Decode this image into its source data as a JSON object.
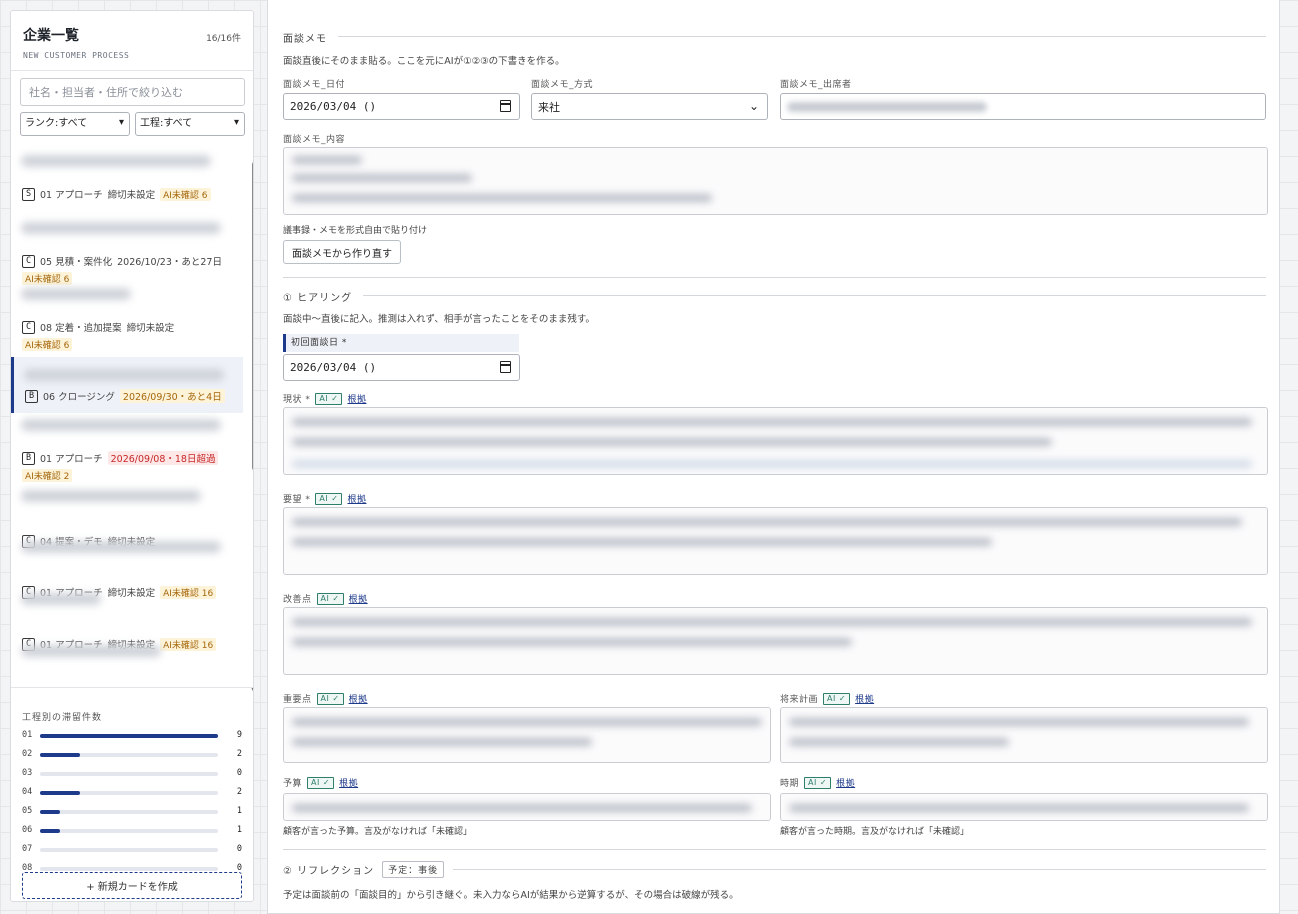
{
  "sidebar": {
    "title": "企業一覧",
    "subtitle": "NEW CUSTOMER PROCESS",
    "count": "16/16件",
    "search_placeholder": "社名・担当者・住所で絞り込む",
    "filter_rank": "ランク:すべて",
    "filter_stage": "工程:すべて",
    "cards": [
      {
        "rank": "S",
        "stage": "01 アプローチ",
        "deadline": "締切未設定",
        "deadline_style": "plain",
        "ai": "AI未確認 6",
        "ai_inline": true
      },
      {
        "rank": "C",
        "stage": "05 見積・案件化",
        "deadline": "2026/10/23・あと27日",
        "deadline_style": "plain",
        "ai": "AI未確認 6",
        "ai_inline": false
      },
      {
        "rank": "C",
        "stage": "08 定着・追加提案",
        "deadline": "締切未設定",
        "deadline_style": "plain",
        "ai": "AI未確認 6",
        "ai_inline": false
      },
      {
        "rank": "B",
        "stage": "06 クロージング",
        "deadline": "2026/09/30・あと4日",
        "deadline_style": "warn",
        "ai": "",
        "ai_inline": true
      },
      {
        "rank": "B",
        "stage": "01 アプローチ",
        "deadline": "2026/09/08・18日超過",
        "deadline_style": "over",
        "ai": "AI未確認 2",
        "ai_inline": false
      },
      {
        "rank": "C",
        "stage": "04 提案・デモ",
        "deadline": "締切未設定",
        "deadline_style": "plain",
        "ai": "",
        "ai_inline": true
      },
      {
        "rank": "C",
        "stage": "01 アプローチ",
        "deadline": "締切未設定",
        "deadline_style": "plain",
        "ai": "AI未確認 16",
        "ai_inline": true
      },
      {
        "rank": "C",
        "stage": "01 アプローチ",
        "deadline": "締切未設定",
        "deadline_style": "plain",
        "ai": "AI未確認 16",
        "ai_inline": true
      },
      {
        "rank": "C",
        "stage": "01 アプローチ",
        "deadline": "締切未設定",
        "deadline_style": "plain",
        "ai": "AI未確認 16",
        "ai_inline": true
      }
    ],
    "stats_title": "工程別の滞留件数",
    "stats": [
      {
        "label": "01",
        "value": 9
      },
      {
        "label": "02",
        "value": 2
      },
      {
        "label": "03",
        "value": 0
      },
      {
        "label": "04",
        "value": 2
      },
      {
        "label": "05",
        "value": 1
      },
      {
        "label": "06",
        "value": 1
      },
      {
        "label": "07",
        "value": 0
      },
      {
        "label": "08",
        "value": 0
      }
    ],
    "stats_max": 9,
    "new_card_label": "+ 新規カードを作成"
  },
  "memo": {
    "heading": "面談メモ",
    "desc": "面談直後にそのまま貼る。ここを元にAIが①②③の下書きを作る。",
    "date_label": "面談メモ_日付",
    "date_value": "2026/03/04 ()",
    "method_label": "面談メモ_方式",
    "method_value": "来社",
    "attendee_label": "面談メモ_出席者",
    "content_label": "面談メモ_内容",
    "paste_hint": "議事録・メモを形式自由で貼り付け",
    "rebuild_button": "面談メモから作り直す"
  },
  "hearing": {
    "heading": "① ヒアリング",
    "desc": "面談中〜直後に記入。推測は入れず、相手が言ったことをそのまま残す。",
    "first_date_label": "初回面談日 *",
    "first_date_value": "2026/03/04 ()",
    "ai_tag": "AI ✓",
    "konkyo": "根拠",
    "status_label": "現状 *",
    "needs_label": "要望 *",
    "improve_label": "改善点",
    "priority_label": "重要点",
    "future_label": "将来計画",
    "budget_label": "予算",
    "timing_label": "時期",
    "budget_hint": "顧客が言った予算。言及がなければ「未確認」",
    "timing_hint": "顧客が言った時期。言及がなければ「未確認」"
  },
  "reflection": {
    "heading": "② リフレクション",
    "tag": "予定：事後",
    "desc": "予定は面談前の「面談目的」から引き継ぐ。未入力ならAIが結果から逆算するが、その場合は破線が残る。"
  }
}
